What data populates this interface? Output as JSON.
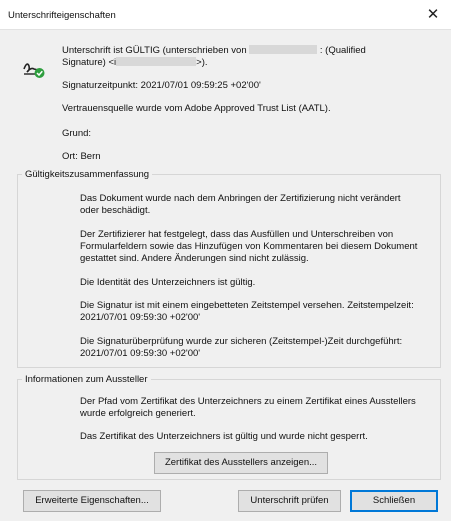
{
  "window": {
    "title": "Unterschrifteigenschaften",
    "close_glyph": "✕"
  },
  "status": {
    "line1_a": "Unterschrift ist GÜLTIG (unterschrieben von",
    "line1_b": ": (Qualified",
    "line2_a": "Signature) <i",
    "line2_b": ">).",
    "time": "Signaturzeitpunkt:  2021/07/01 09:59:25 +02'00'",
    "trust": "Vertrauensquelle wurde vom Adobe Approved Trust List (AATL).",
    "reason": "Grund:",
    "location": "Ort: Bern",
    "icon": "signature-valid-icon",
    "icon_color": "#2e9e3e"
  },
  "validity": {
    "legend": "Gültigkeitszusammenfassung",
    "p1": [
      "Das Dokument wurde nach dem Anbringen der Zertifizierung nicht verändert",
      "oder beschädigt."
    ],
    "p2": [
      "Der Zertifizierer hat festgelegt, dass das Ausfüllen und Unterschreiben von",
      "Formularfeldern sowie das Hinzufügen von Kommentaren bei diesem Dokument",
      "gestattet sind. Andere Änderungen sind nicht zulässig."
    ],
    "p3": [
      "Die Identität des Unterzeichners ist gültig."
    ],
    "p4": [
      "Die Signatur ist mit einem eingebetteten Zeitstempel versehen. Zeitstempelzeit:",
      "2021/07/01 09:59:30 +02'00'"
    ],
    "p5": [
      "Die Signaturüberprüfung wurde zur sicheren (Zeitstempel-)Zeit durchgeführt:",
      "2021/07/01 09:59:30 +02'00'"
    ]
  },
  "issuer": {
    "legend": "Informationen zum Aussteller",
    "p1": [
      "Der Pfad vom Zertifikat des Unterzeichners zu einem Zertifikat eines Ausstellers",
      "wurde erfolgreich generiert."
    ],
    "p2": [
      "Das Zertifikat des Unterzeichners ist gültig und wurde nicht gesperrt."
    ],
    "show_cert_button": "Zertifikat des Ausstellers anzeigen..."
  },
  "footer": {
    "advanced_button": "Erweiterte Eigenschaften...",
    "validate_button": "Unterschrift prüfen",
    "close_button": "Schließen"
  }
}
